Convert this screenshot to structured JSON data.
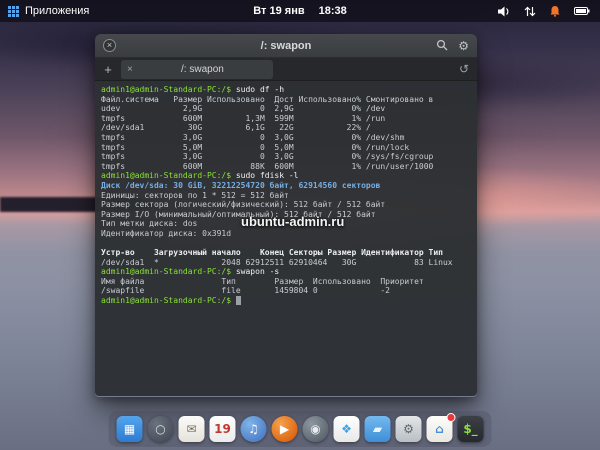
{
  "panel": {
    "app_menu_label": "Приложения",
    "clock_date": "Вт 19 янв",
    "clock_time": "18:38",
    "indicator_icons": [
      "volume-icon",
      "network-icon",
      "notifications-icon",
      "battery-icon"
    ]
  },
  "window": {
    "title": "/: swapon",
    "tab_label": "/: swapon",
    "close_glyph": "×",
    "new_tab_glyph": "+",
    "tab_close_glyph": "×",
    "history_glyph": "↺",
    "menu_glyph": "⚙"
  },
  "watermark": "ubuntu-admin.ru",
  "colors": {
    "prompt_green": "#8ae234",
    "info_blue": "#76aee3",
    "notification_orange": "#f37329",
    "badge_red": "#e8383c"
  },
  "terminal": {
    "lines": [
      {
        "segments": [
          {
            "style": "prompt",
            "text": "admin1@admin-Standard-PC:/$ "
          },
          {
            "style": "cmd",
            "text": "sudo df -h"
          }
        ]
      },
      {
        "segments": [
          {
            "style": "out",
            "text": "Файл.система   Размер Использовано  Дост Использовано% Смонтировано в"
          }
        ]
      },
      {
        "segments": [
          {
            "style": "out",
            "text": "udev             2,9G            0  2,9G            0% /dev"
          }
        ]
      },
      {
        "segments": [
          {
            "style": "out",
            "text": "tmpfs            600M         1,3M  599M            1% /run"
          }
        ]
      },
      {
        "segments": [
          {
            "style": "out",
            "text": "/dev/sda1         30G         6,1G   22G           22% /"
          }
        ]
      },
      {
        "segments": [
          {
            "style": "out",
            "text": "tmpfs            3,0G            0  3,0G            0% /dev/shm"
          }
        ]
      },
      {
        "segments": [
          {
            "style": "out",
            "text": "tmpfs            5,0M            0  5,0M            0% /run/lock"
          }
        ]
      },
      {
        "segments": [
          {
            "style": "out",
            "text": "tmpfs            3,0G            0  3,0G            0% /sys/fs/cgroup"
          }
        ]
      },
      {
        "segments": [
          {
            "style": "out",
            "text": "tmpfs            600M          88K  600M            1% /run/user/1000"
          }
        ]
      },
      {
        "segments": [
          {
            "style": "prompt",
            "text": "admin1@admin-Standard-PC:/$ "
          },
          {
            "style": "cmd",
            "text": "sudo fdisk -l"
          }
        ]
      },
      {
        "segments": [
          {
            "style": "disk",
            "text": "Диск /dev/sda: 30 GiB, 32212254720 байт, 62914560 секторов"
          }
        ]
      },
      {
        "segments": [
          {
            "style": "out",
            "text": "Единицы: секторов по 1 * 512 = 512 байт"
          }
        ]
      },
      {
        "segments": [
          {
            "style": "out",
            "text": "Размер сектора (логический/физический): 512 байт / 512 байт"
          }
        ]
      },
      {
        "segments": [
          {
            "style": "out",
            "text": "Размер I/O (минимальный/оптимальный): 512 байт / 512 байт"
          }
        ]
      },
      {
        "segments": [
          {
            "style": "out",
            "text": "Тип метки диска: dos"
          }
        ]
      },
      {
        "segments": [
          {
            "style": "out",
            "text": "Идентификатор диска: 0x391d"
          }
        ]
      },
      {
        "segments": []
      },
      {
        "segments": [
          {
            "style": "hdr",
            "text": "Устр-во    Загрузочный начало    Конец Секторы Размер Идентификатор Тип"
          }
        ]
      },
      {
        "segments": [
          {
            "style": "out",
            "text": "/dev/sda1  *             2048 62912511 62910464   30G            83 Linux"
          }
        ]
      },
      {
        "segments": [
          {
            "style": "prompt",
            "text": "admin1@admin-Standard-PC:/$ "
          },
          {
            "style": "cmd",
            "text": "swapon -s"
          }
        ]
      },
      {
        "segments": [
          {
            "style": "out",
            "text": "Имя файла                Тип        Размер  Использовано  Приоритет"
          }
        ]
      },
      {
        "segments": [
          {
            "style": "out",
            "text": "/swapfile                file       1459804 0             -2"
          }
        ]
      },
      {
        "segments": [
          {
            "style": "prompt",
            "text": "admin1@admin-Standard-PC:/$ "
          },
          {
            "style": "cursor",
            "text": " "
          }
        ]
      }
    ]
  },
  "dock": {
    "items": [
      {
        "name": "multitasking",
        "glyph": "▦",
        "bg": "linear-gradient(180deg,#54a4ec,#2f7bd0)",
        "color": "#ffffff"
      },
      {
        "name": "browser",
        "glyph": "○",
        "bg": "radial-gradient(circle at 35% 30%, #6a7280, #3f454e)",
        "color": "#d7dde3",
        "shape": "circle"
      },
      {
        "name": "mail",
        "glyph": "✉",
        "bg": "linear-gradient(180deg,#fbfbf9,#e4e2da)",
        "color": "#7a6f5f"
      },
      {
        "name": "calendar",
        "glyph": "19",
        "bg": "linear-gradient(180deg,#ffffff,#ececec)",
        "color": "#c0392b"
      },
      {
        "name": "music",
        "glyph": "♫",
        "bg": "radial-gradient(circle at 35% 30%, #7fb3e8, #3f6fbf)",
        "color": "#ffffff",
        "shape": "circle"
      },
      {
        "name": "videos",
        "glyph": "▶",
        "bg": "radial-gradient(circle at 35% 30%, #f6a14e, #d35400)",
        "color": "#ffffff",
        "shape": "circle"
      },
      {
        "name": "camera",
        "glyph": "◉",
        "bg": "radial-gradient(circle at 35% 30%, #8d97a0, #4e565e)",
        "color": "#e8edf2",
        "shape": "circle"
      },
      {
        "name": "photos",
        "glyph": "❖",
        "bg": "linear-gradient(180deg,#ffffff,#e8e8e8)",
        "color": "#3aa3e3"
      },
      {
        "name": "files",
        "glyph": "▰",
        "bg": "linear-gradient(180deg,#74b9f0,#3d8fd6)",
        "color": "#eaf4fd"
      },
      {
        "name": "settings",
        "glyph": "⚙",
        "bg": "linear-gradient(180deg,#e3e6e8,#b9bfc4)",
        "color": "#5b6670"
      },
      {
        "name": "appcenter",
        "glyph": "⌂",
        "bg": "linear-gradient(180deg,#fdfdfb,#e9e7e0)",
        "color": "#4a90d9",
        "badge": true
      },
      {
        "name": "terminal",
        "glyph": "$_",
        "bg": "linear-gradient(180deg,#3b4046,#26292d)",
        "color": "#8ae234"
      }
    ]
  }
}
